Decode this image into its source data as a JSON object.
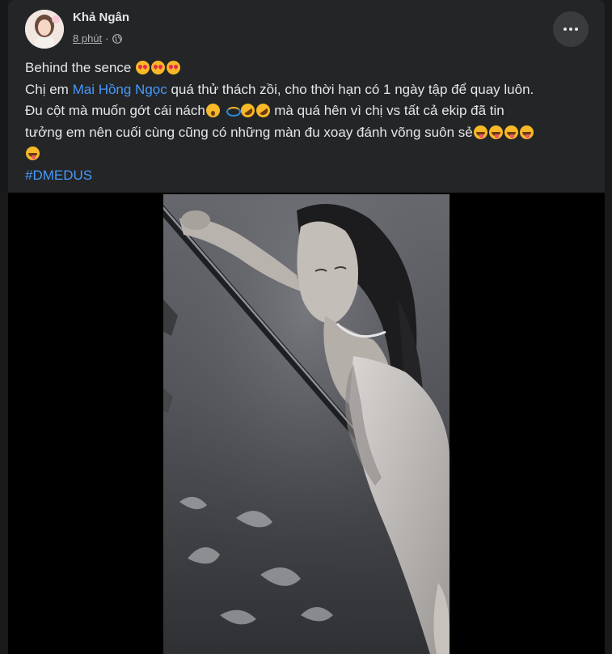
{
  "post": {
    "author": "Khả Ngân",
    "time": "8 phút",
    "separator": "·",
    "privacy_icon": "globe-icon",
    "more_icon": "more-options-icon",
    "text": {
      "line1": "Behind the sence",
      "line2_pre": "Chị em ",
      "mention": "Mai Hồng Ngọc",
      "line2_post": " quá thử thách zồi, cho thời hạn có 1 ngày tập để quay luôn.",
      "line3_pre": "Đu cột mà muốn gớt cái nách",
      "line3_post": " mà quá hên vì chị vs tất cả ekip đã tin",
      "line4": "tưởng em nên cuối cùng cũng có những màn đu xoay đánh võng suôn sẻ",
      "hashtag": "#DMEDUS"
    },
    "emojis": {
      "line1": [
        "smiling-face-with-hearts",
        "smiling-face-with-hearts",
        "smiling-face-with-hearts"
      ],
      "line3": [
        "astonished-face",
        "spinning-arrows",
        "rolling-on-floor-laughing",
        "rolling-on-floor-laughing"
      ],
      "line4": [
        "face-with-tongue",
        "face-with-tongue",
        "face-with-tongue",
        "face-with-tongue"
      ],
      "line5": [
        "face-with-tongue"
      ]
    }
  },
  "colors": {
    "background": "#18191a",
    "card": "#242526",
    "text_primary": "#e4e6eb",
    "text_secondary": "#b0b3b8",
    "link": "#4599ff"
  }
}
